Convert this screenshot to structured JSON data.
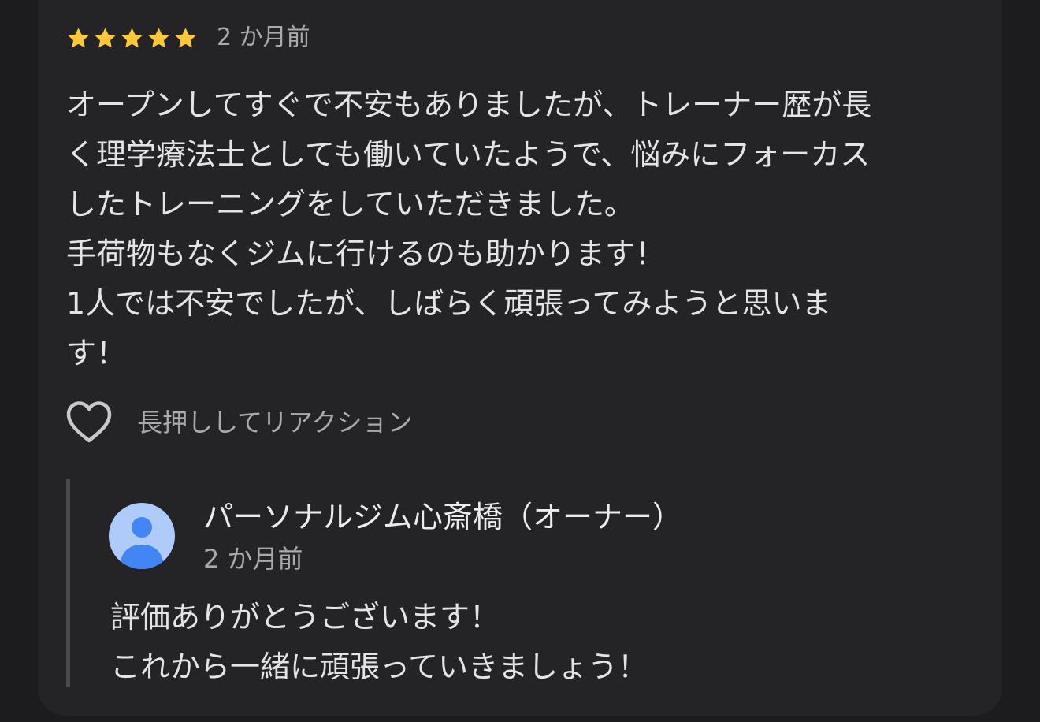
{
  "review": {
    "rating": 5,
    "max_rating": 5,
    "star_color": "#fcc934",
    "time": "2 か月前",
    "text_lines": [
      "オープンしてすぐで不安もありましたが、トレーナー歴が長",
      "く理学療法士としても働いていたようで、悩みにフォーカス",
      "したトレーニングをしていただきました。",
      "手荷物もなくジムに行けるのも助かります！",
      "1人では不安でしたが、しばらく頑張ってみようと思いま",
      "す！"
    ]
  },
  "reaction": {
    "icon": "heart-outline-icon",
    "label": "長押ししてリアクション"
  },
  "owner_reply": {
    "avatar_icon": "person-avatar-icon",
    "avatar_color": "#aecbfa",
    "avatar_figure_color": "#4285f4",
    "name": "パーソナルジム心斎橋（オーナー）",
    "time": "2 か月前",
    "text_lines": [
      "評価ありがとうございます！",
      "これから一緒に頑張っていきましょう！"
    ]
  }
}
